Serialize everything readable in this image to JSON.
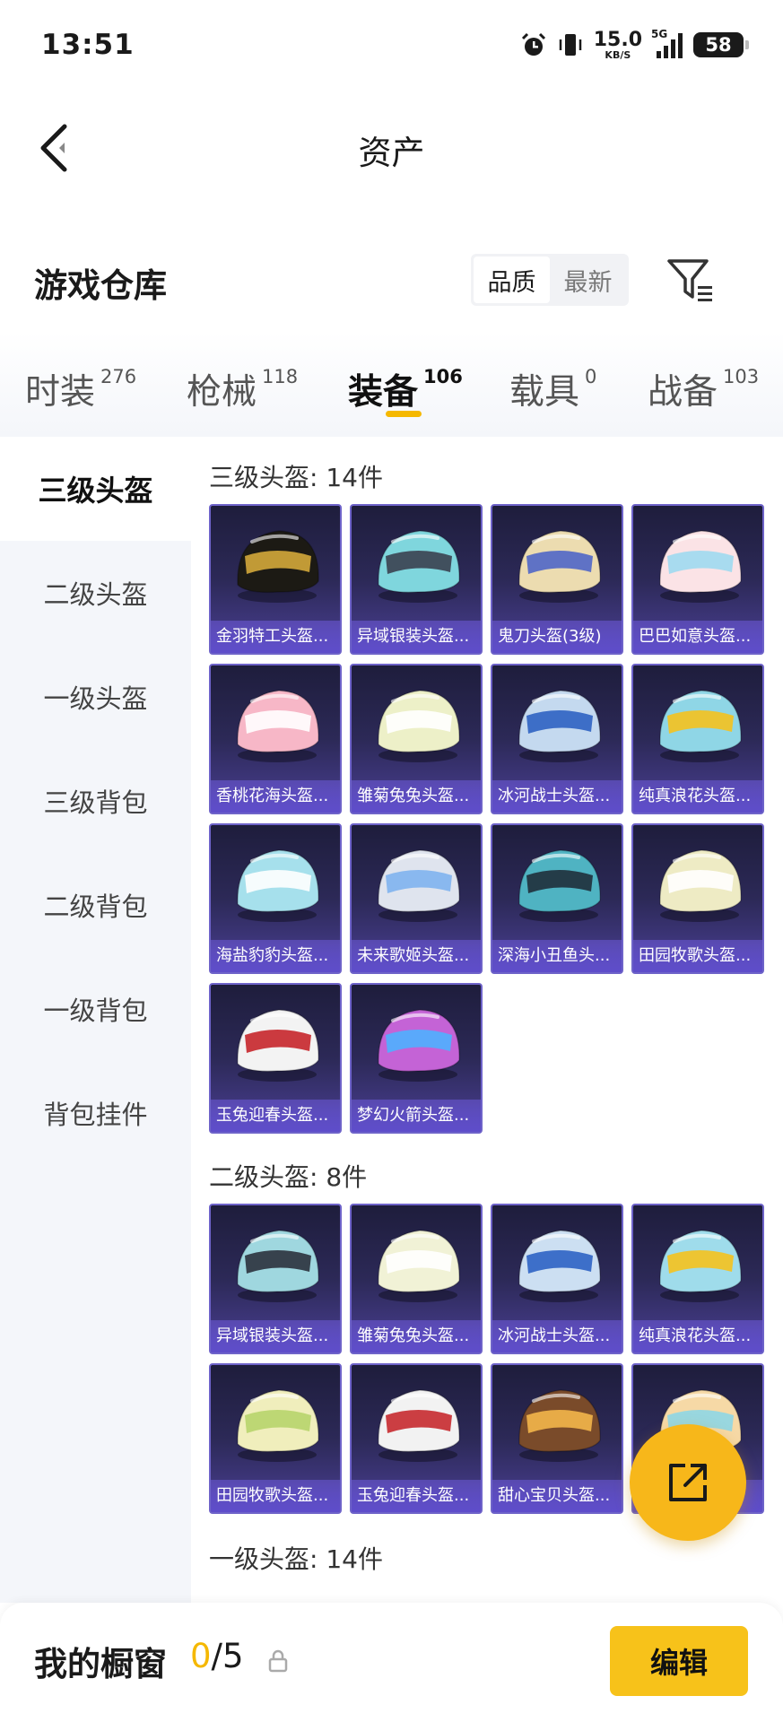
{
  "status_bar": {
    "time": "13:51",
    "net_speed": "15.0",
    "net_unit": "KB/S",
    "network_type": "5G",
    "battery": "58"
  },
  "header": {
    "title": "资产"
  },
  "warehouse": {
    "title": "游戏仓库",
    "sort_options": [
      "品质",
      "最新"
    ],
    "active_sort": "品质"
  },
  "tabs": [
    {
      "label": "时装",
      "count": "276"
    },
    {
      "label": "枪械",
      "count": "118"
    },
    {
      "label": "装备",
      "count": "106"
    },
    {
      "label": "载具",
      "count": "0"
    },
    {
      "label": "战备",
      "count": "103"
    }
  ],
  "active_tab": "装备",
  "sidebar": {
    "items": [
      "三级头盔",
      "二级头盔",
      "一级头盔",
      "三级背包",
      "二级背包",
      "一级背包",
      "背包挂件"
    ],
    "active": "三级头盔"
  },
  "groups": [
    {
      "title": "三级头盔: 14件",
      "items": [
        {
          "name": "金羽特工头盔...",
          "color": "#1c1a14",
          "accent": "#d4a83a"
        },
        {
          "name": "异域银装头盔...",
          "color": "#7fd6dd",
          "accent": "#3b4150"
        },
        {
          "name": "鬼刀头盔(3级)",
          "color": "#ecdcb0",
          "accent": "#5066c8"
        },
        {
          "name": "巴巴如意头盔...",
          "color": "#fbe3e6",
          "accent": "#9fd9f0"
        },
        {
          "name": "香桃花海头盔...",
          "color": "#f7b7c7",
          "accent": "#ffffff"
        },
        {
          "name": "雏菊兔兔头盔...",
          "color": "#edf0c8",
          "accent": "#ffffff"
        },
        {
          "name": "冰河战士头盔...",
          "color": "#c4d9ef",
          "accent": "#2f62c2"
        },
        {
          "name": "纯真浪花头盔...",
          "color": "#8fd6e6",
          "accent": "#f5c21e"
        },
        {
          "name": "海盐豹豹头盔...",
          "color": "#a6e0ec",
          "accent": "#ffffff"
        },
        {
          "name": "未来歌姬头盔...",
          "color": "#dfe4ee",
          "accent": "#7fb2ee"
        },
        {
          "name": "深海小丑鱼头...",
          "color": "#4fb3c2",
          "accent": "#1f2f3b"
        },
        {
          "name": "田园牧歌头盔...",
          "color": "#eeebc4",
          "accent": "#ffffff"
        },
        {
          "name": "玉兔迎春头盔...",
          "color": "#f3f3f3",
          "accent": "#c6262b"
        },
        {
          "name": "梦幻火箭头盔...",
          "color": "#c463d6",
          "accent": "#4fb0ff"
        }
      ]
    },
    {
      "title": "二级头盔: 8件",
      "items": [
        {
          "name": "异域银装头盔...",
          "color": "#9fd7df",
          "accent": "#2b323d"
        },
        {
          "name": "雏菊兔兔头盔...",
          "color": "#f1f2d6",
          "accent": "#ffffff"
        },
        {
          "name": "冰河战士头盔...",
          "color": "#ccdff2",
          "accent": "#2d63c4"
        },
        {
          "name": "纯真浪花头盔...",
          "color": "#9fdceb",
          "accent": "#f5c21e"
        },
        {
          "name": "田园牧歌头盔...",
          "color": "#f0eebc",
          "accent": "#b7d46b"
        },
        {
          "name": "玉兔迎春头盔...",
          "color": "#f2f2f2",
          "accent": "#c62a2f"
        },
        {
          "name": "甜心宝贝头盔...",
          "color": "#7a4b2a",
          "accent": "#f3b64a"
        },
        {
          "name": "",
          "color": "#f6d9a6",
          "accent": "#8fd6e6"
        }
      ]
    },
    {
      "title": "一级头盔: 14件",
      "items": []
    }
  ],
  "bottom_bar": {
    "label": "我的橱窗",
    "current": "0",
    "total": "/5",
    "edit_label": "编辑"
  },
  "colors": {
    "accent": "#f5b800",
    "card_border": "#6e63c9",
    "card_bg": "#2c2957"
  },
  "icons": [
    "back-chevron-icon",
    "filter-icon",
    "share-icon",
    "lock-icon",
    "alarm-icon",
    "vibrate-icon",
    "signal-icon",
    "battery-icon"
  ]
}
